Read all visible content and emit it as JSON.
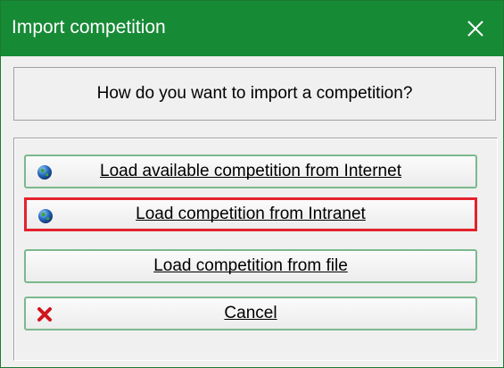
{
  "window": {
    "title": "Import competition",
    "close_glyph": "✕"
  },
  "prompt": {
    "question": "How do you want to import a competition?"
  },
  "buttons": [
    {
      "label": "Load available competition from Internet",
      "icon": "globe-icon"
    },
    {
      "label": "Load competition from Intranet",
      "icon": "globe-icon",
      "selected": true
    },
    {
      "label": "Load competition from file",
      "icon": ""
    },
    {
      "label": "Cancel",
      "icon": "red-x-icon"
    }
  ],
  "colors": {
    "titlebar": "#178a36",
    "selection_outline": "#e3222c",
    "button_border": "#7bb98c"
  }
}
